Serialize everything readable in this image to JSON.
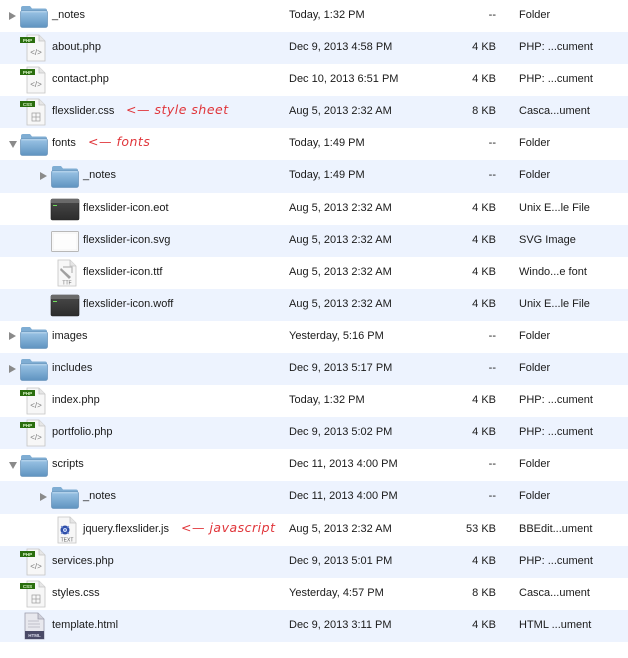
{
  "window": {
    "view": "Finder list view"
  },
  "colors": {
    "row_alt": "#edf3fe",
    "row_base": "#ffffff",
    "annotation": "#e0353a",
    "folder": "#7fb0d8",
    "php_badge": "#2a6e0e"
  },
  "rows": [
    {
      "name": "_notes",
      "level": 0,
      "disclosure": "closed",
      "icon": "folder-icon",
      "date": "Today, 1:32 PM",
      "size": "--",
      "kind": "Folder"
    },
    {
      "name": "about.php",
      "level": 0,
      "disclosure": "none",
      "icon": "php-file-icon",
      "badge": "PHP",
      "date": "Dec 9, 2013 4:58 PM",
      "size": "4 KB",
      "kind": "PHP: ...cument"
    },
    {
      "name": "contact.php",
      "level": 0,
      "disclosure": "none",
      "icon": "php-file-icon",
      "badge": "PHP",
      "date": "Dec 10, 2013 6:51 PM",
      "size": "4 KB",
      "kind": "PHP: ...cument"
    },
    {
      "name": "flexslider.css",
      "level": 0,
      "disclosure": "none",
      "icon": "css-file-icon",
      "badge": "CSS",
      "note": "<— style sheet",
      "date": "Aug 5, 2013 2:32 AM",
      "size": "8 KB",
      "kind": "Casca...ument"
    },
    {
      "name": "fonts",
      "level": 0,
      "disclosure": "open",
      "icon": "folder-icon",
      "note": "<— fonts",
      "date": "Today, 1:49 PM",
      "size": "--",
      "kind": "Folder"
    },
    {
      "name": "_notes",
      "level": 1,
      "disclosure": "closed",
      "icon": "folder-icon",
      "date": "Today, 1:49 PM",
      "size": "--",
      "kind": "Folder"
    },
    {
      "name": "flexslider-icon.eot",
      "level": 1,
      "disclosure": "none",
      "icon": "unix-executable-icon",
      "date": "Aug 5, 2013 2:32 AM",
      "size": "4 KB",
      "kind": "Unix E...le File"
    },
    {
      "name": "flexslider-icon.svg",
      "level": 1,
      "disclosure": "none",
      "icon": "svg-image-icon",
      "date": "Aug 5, 2013 2:32 AM",
      "size": "4 KB",
      "kind": "SVG Image"
    },
    {
      "name": "flexslider-icon.ttf",
      "level": 1,
      "disclosure": "none",
      "icon": "ttf-font-icon",
      "badge": "TTF",
      "date": "Aug 5, 2013 2:32 AM",
      "size": "4 KB",
      "kind": "Windo...e font"
    },
    {
      "name": "flexslider-icon.woff",
      "level": 1,
      "disclosure": "none",
      "icon": "unix-executable-icon",
      "date": "Aug 5, 2013 2:32 AM",
      "size": "4 KB",
      "kind": "Unix E...le File"
    },
    {
      "name": "images",
      "level": 0,
      "disclosure": "closed",
      "icon": "folder-icon",
      "date": "Yesterday, 5:16 PM",
      "size": "--",
      "kind": "Folder"
    },
    {
      "name": "includes",
      "level": 0,
      "disclosure": "closed",
      "icon": "folder-icon",
      "date": "Dec 9, 2013 5:17 PM",
      "size": "--",
      "kind": "Folder"
    },
    {
      "name": "index.php",
      "level": 0,
      "disclosure": "none",
      "icon": "php-file-icon",
      "badge": "PHP",
      "date": "Today, 1:32 PM",
      "size": "4 KB",
      "kind": "PHP: ...cument"
    },
    {
      "name": "portfolio.php",
      "level": 0,
      "disclosure": "none",
      "icon": "php-file-icon",
      "badge": "PHP",
      "date": "Dec 9, 2013 5:02 PM",
      "size": "4 KB",
      "kind": "PHP: ...cument"
    },
    {
      "name": "scripts",
      "level": 0,
      "disclosure": "open",
      "icon": "folder-icon",
      "date": "Dec 11, 2013 4:00 PM",
      "size": "--",
      "kind": "Folder"
    },
    {
      "name": "_notes",
      "level": 1,
      "disclosure": "closed",
      "icon": "folder-icon",
      "date": "Dec 11, 2013 4:00 PM",
      "size": "--",
      "kind": "Folder"
    },
    {
      "name": "jquery.flexslider.js",
      "level": 1,
      "disclosure": "none",
      "icon": "bbedit-text-icon",
      "badge": "TEXT",
      "note": "<— javascript",
      "date": "Aug 5, 2013 2:32 AM",
      "size": "53 KB",
      "kind": "BBEdit...ument"
    },
    {
      "name": "services.php",
      "level": 0,
      "disclosure": "none",
      "icon": "php-file-icon",
      "badge": "PHP",
      "date": "Dec 9, 2013 5:01 PM",
      "size": "4 KB",
      "kind": "PHP: ...cument"
    },
    {
      "name": "styles.css",
      "level": 0,
      "disclosure": "none",
      "icon": "css-file-icon",
      "badge": "CSS",
      "date": "Yesterday, 4:57 PM",
      "size": "8 KB",
      "kind": "Casca...ument"
    },
    {
      "name": "template.html",
      "level": 0,
      "disclosure": "none",
      "icon": "html-file-icon",
      "badge": "HTML",
      "date": "Dec 9, 2013 3:11 PM",
      "size": "4 KB",
      "kind": "HTML ...ument"
    }
  ]
}
